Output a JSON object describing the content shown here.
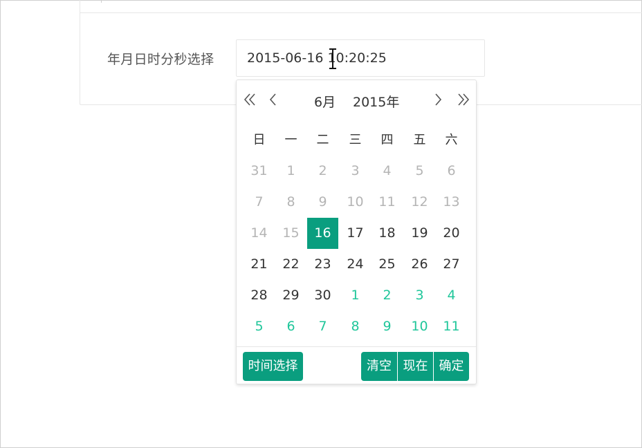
{
  "form": {
    "label": "年月日时分秒选择",
    "value": "2015-06-16 10:20:25"
  },
  "picker": {
    "month": "6月",
    "year": "2015年",
    "weekdays": [
      "日",
      "一",
      "二",
      "三",
      "四",
      "五",
      "六"
    ],
    "weeks": [
      [
        {
          "d": "31",
          "t": "prev"
        },
        {
          "d": "1",
          "t": "prev"
        },
        {
          "d": "2",
          "t": "prev"
        },
        {
          "d": "3",
          "t": "prev"
        },
        {
          "d": "4",
          "t": "prev"
        },
        {
          "d": "5",
          "t": "prev"
        },
        {
          "d": "6",
          "t": "prev"
        }
      ],
      [
        {
          "d": "7",
          "t": "prev"
        },
        {
          "d": "8",
          "t": "prev"
        },
        {
          "d": "9",
          "t": "prev"
        },
        {
          "d": "10",
          "t": "prev"
        },
        {
          "d": "11",
          "t": "prev"
        },
        {
          "d": "12",
          "t": "prev"
        },
        {
          "d": "13",
          "t": "prev"
        }
      ],
      [
        {
          "d": "14",
          "t": "prev"
        },
        {
          "d": "15",
          "t": "prev"
        },
        {
          "d": "16",
          "t": "sel"
        },
        {
          "d": "17",
          "t": "cur"
        },
        {
          "d": "18",
          "t": "cur"
        },
        {
          "d": "19",
          "t": "cur"
        },
        {
          "d": "20",
          "t": "cur"
        }
      ],
      [
        {
          "d": "21",
          "t": "cur"
        },
        {
          "d": "22",
          "t": "cur"
        },
        {
          "d": "23",
          "t": "cur"
        },
        {
          "d": "24",
          "t": "cur"
        },
        {
          "d": "25",
          "t": "cur"
        },
        {
          "d": "26",
          "t": "cur"
        },
        {
          "d": "27",
          "t": "cur"
        }
      ],
      [
        {
          "d": "28",
          "t": "cur"
        },
        {
          "d": "29",
          "t": "cur"
        },
        {
          "d": "30",
          "t": "cur"
        },
        {
          "d": "1",
          "t": "next"
        },
        {
          "d": "2",
          "t": "next"
        },
        {
          "d": "3",
          "t": "next"
        },
        {
          "d": "4",
          "t": "next"
        }
      ],
      [
        {
          "d": "5",
          "t": "next"
        },
        {
          "d": "6",
          "t": "next"
        },
        {
          "d": "7",
          "t": "next"
        },
        {
          "d": "8",
          "t": "next"
        },
        {
          "d": "9",
          "t": "next"
        },
        {
          "d": "10",
          "t": "next"
        },
        {
          "d": "11",
          "t": "next"
        }
      ]
    ],
    "footer": {
      "time_select": "时间选择",
      "clear": "清空",
      "now": "现在",
      "confirm": "确定"
    }
  },
  "colors": {
    "accent": "#0a9e7f",
    "next_month_text": "#1fc69a",
    "disabled_text": "#b4b4b4"
  },
  "icons": {
    "prev_year": "double-chevron-left-icon",
    "prev_month": "chevron-left-icon",
    "next_month": "chevron-right-icon",
    "next_year": "double-chevron-right-icon",
    "cursor": "text-cursor-icon"
  }
}
